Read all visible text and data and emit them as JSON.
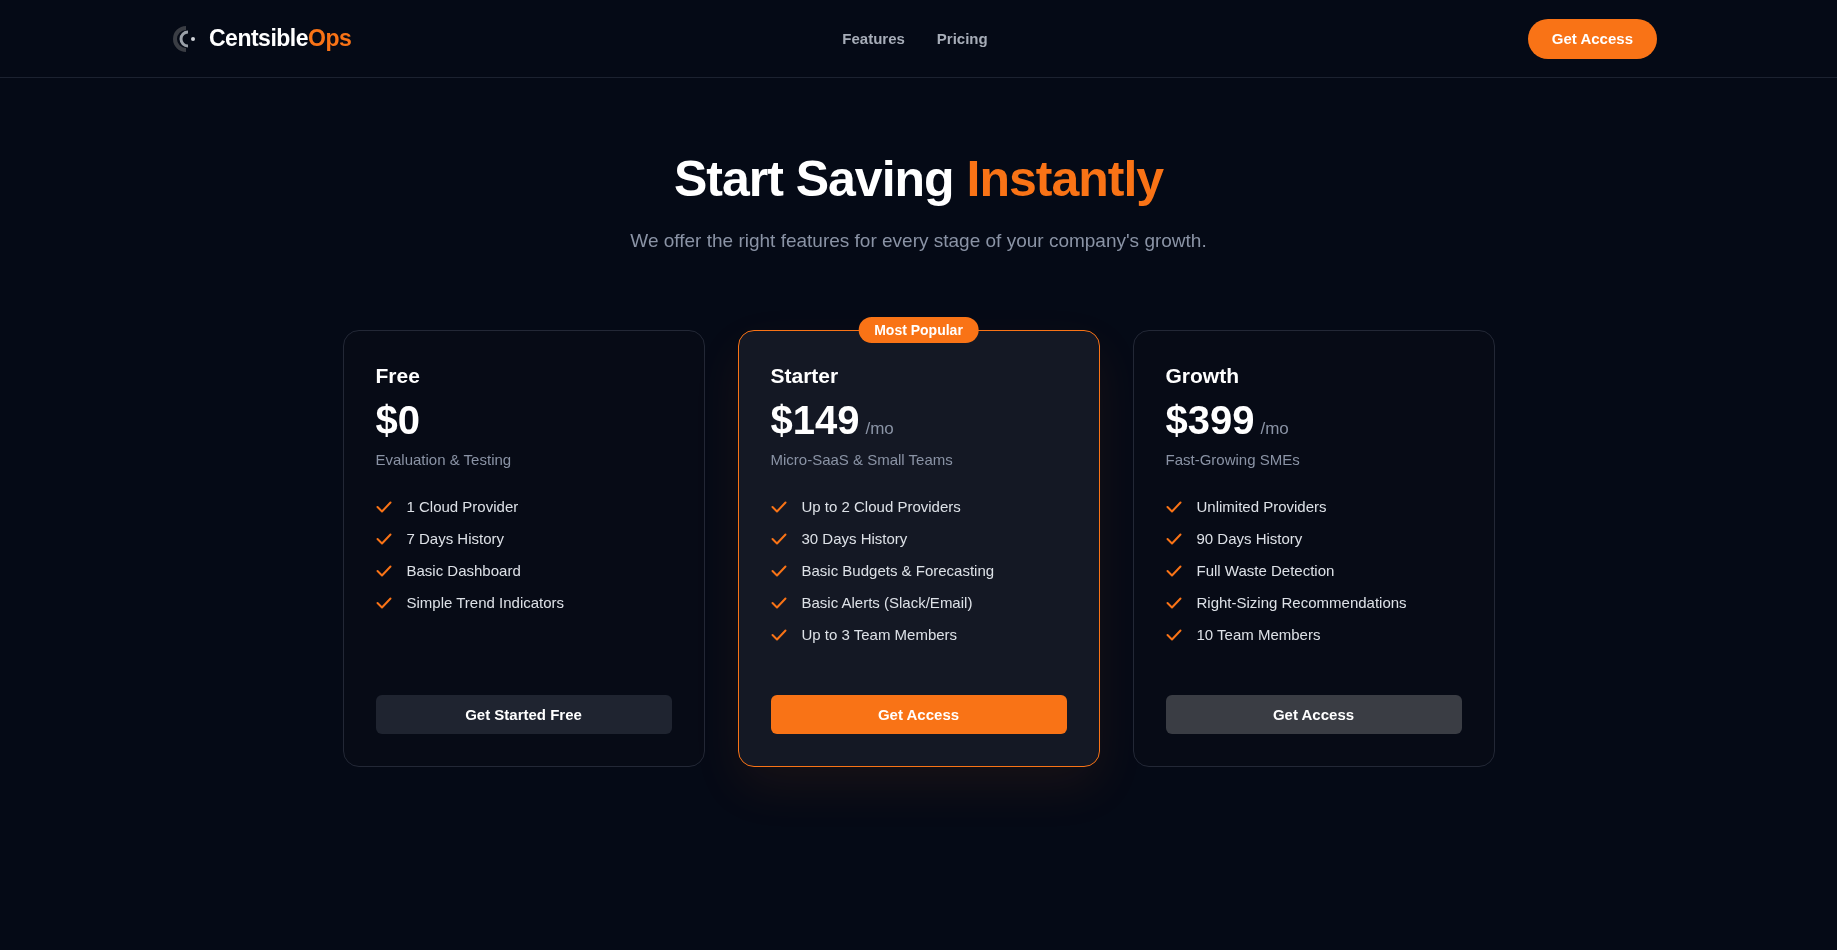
{
  "header": {
    "logo": {
      "text": "Centsible",
      "accent": "Ops"
    },
    "nav": [
      "Features",
      "Pricing"
    ],
    "cta": "Get Access"
  },
  "hero": {
    "title": "Start Saving",
    "title_accent": "Instantly",
    "subtitle": "We offer the right features for every stage of your company's growth."
  },
  "plans": [
    {
      "name": "Free",
      "price": "$0",
      "tagline": "Evaluation & Testing",
      "highlighted": false,
      "features": [
        "1 Cloud Provider",
        "7 Days History",
        "Basic Dashboard",
        "Simple Trend Indicators"
      ],
      "button": {
        "label": "Get Started Free",
        "kind": "secondary"
      }
    },
    {
      "name": "Starter",
      "price": "$149",
      "period": "/mo",
      "badge": "Most Popular",
      "tagline": "Micro-SaaS & Small Teams",
      "highlighted": true,
      "features": [
        "Up to 2 Cloud Providers",
        "30 Days History",
        "Basic Budgets & Forecasting",
        "Basic Alerts (Slack/Email)",
        "Up to 3 Team Members"
      ],
      "button": {
        "label": "Get Access",
        "kind": "primary"
      }
    },
    {
      "name": "Growth",
      "price": "$399",
      "period": "/mo",
      "tagline": "Fast-Growing SMEs",
      "highlighted": false,
      "features": [
        "Unlimited Providers",
        "90 Days History",
        "Full Waste Detection",
        "Right-Sizing Recommendations",
        "10 Team Members"
      ],
      "button": {
        "label": "Get Access",
        "kind": "muted"
      }
    }
  ]
}
